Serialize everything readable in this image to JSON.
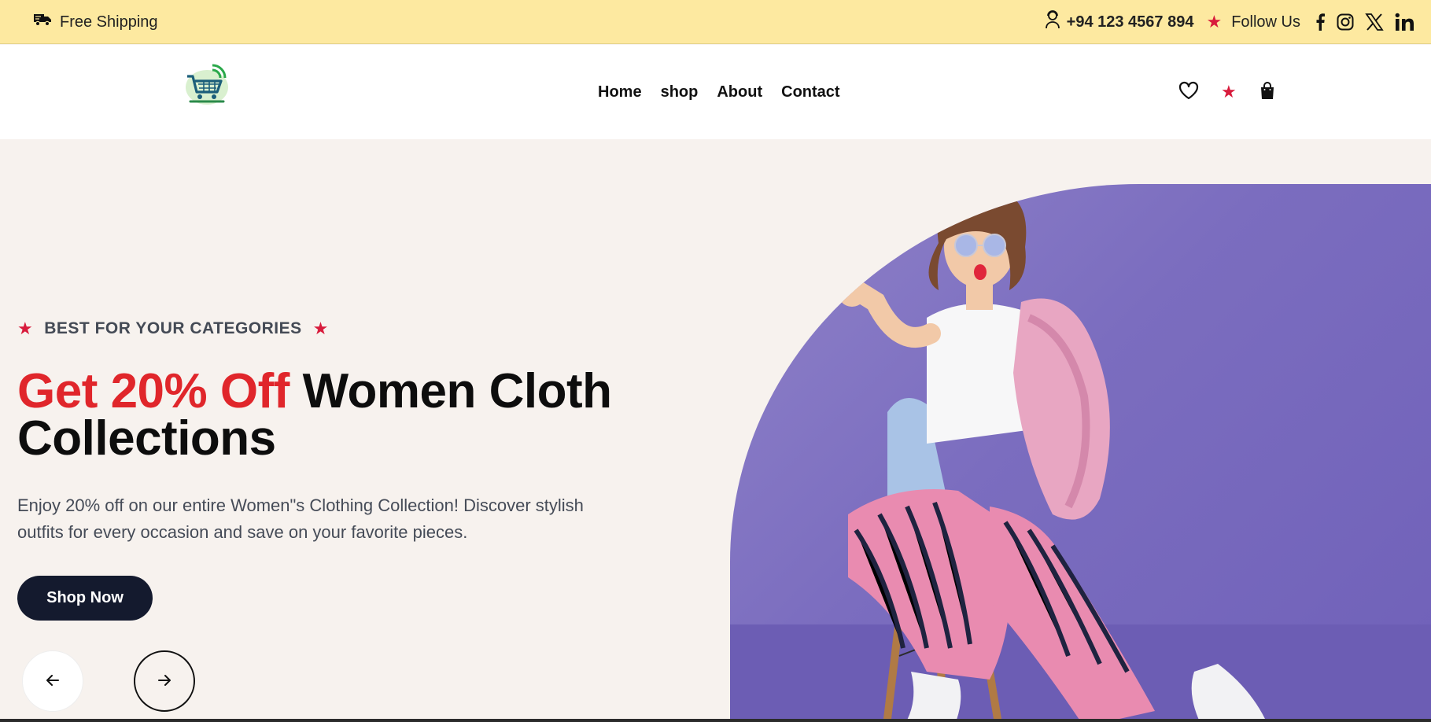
{
  "topbar": {
    "shipping_text": "Free Shipping",
    "phone": "+94 123 4567 894",
    "follow_text": "Follow Us",
    "social_icons": [
      "facebook-icon",
      "instagram-icon",
      "x-icon",
      "linkedin-icon"
    ]
  },
  "header": {
    "nav": [
      "Home",
      "shop",
      "About",
      "Contact"
    ],
    "icons": [
      "heart-icon",
      "star-icon",
      "shopping-bag-icon"
    ]
  },
  "hero": {
    "tagline": "BEST FOR YOUR CATEGORIES",
    "headline_accent": "Get 20% Off",
    "headline_rest": "Women Cloth Collections",
    "description": "Enjoy 20% off on our entire Women\"s Clothing Collection! Discover stylish outfits for every occasion and save on your favorite pieces.",
    "cta": "Shop Now"
  },
  "colors": {
    "topbar_bg": "#fde9a0",
    "hero_bg": "#f7f2ee",
    "accent_red": "#e0262b",
    "star_red": "#d81b3c",
    "button_dark": "#141a2e",
    "image_purple": "#7b6dbf"
  }
}
